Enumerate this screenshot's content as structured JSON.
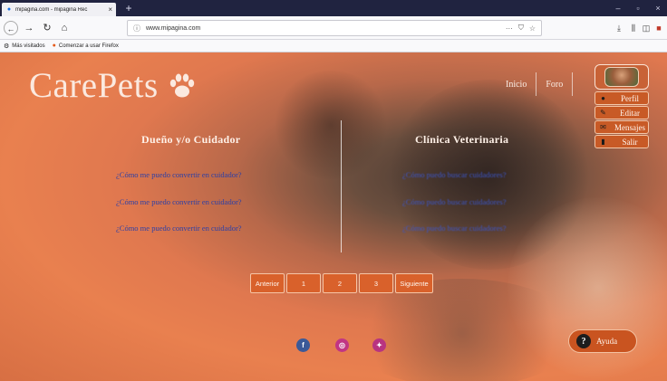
{
  "browser": {
    "tab_title": "mipagina.com - mipagina Rec",
    "tab_close": "×",
    "new_tab": "+",
    "url": "www.mipagina.com",
    "url_info_icon": "ⓘ",
    "url_more": "···",
    "url_shield": "⛉",
    "url_star": "☆",
    "win_min": "–",
    "win_max": "▫",
    "win_close": "×",
    "bookmarks": [
      {
        "label": "Más visitados",
        "icon": "gear-icon"
      },
      {
        "label": "Comenzar a usar Firefox",
        "icon": "firefox-icon"
      }
    ]
  },
  "site": {
    "logo": "CarePets",
    "nav": [
      "Inicio",
      "Foro"
    ],
    "user_menu": [
      {
        "label": "Perfil",
        "icon": "user-icon"
      },
      {
        "label": "Editar",
        "icon": "pencil-icon"
      },
      {
        "label": "Mensajes",
        "icon": "envelope-icon"
      },
      {
        "label": "Salir",
        "icon": "door-icon"
      }
    ],
    "left_title": "Dueño y/o Cuidador",
    "right_title": "Clínica Veterinaria",
    "left_questions": [
      "¿Cómo me puedo convertir en cuidador?",
      "¿Cómo me puedo convertir en cuidador?",
      "¿Cómo me puedo convertir en cuidador?"
    ],
    "right_questions": [
      "¿Cómo puedo buscar cuidadores?",
      "¿Cómo puedo buscar cuidadores?",
      "¿Cómo puedo buscar cuidadores?"
    ],
    "pagination": [
      "Anterior",
      "1",
      "2",
      "3",
      "Siguiente"
    ],
    "social": [
      {
        "name": "facebook-icon",
        "glyph": "f",
        "color": "#3b5998"
      },
      {
        "name": "instagram-icon",
        "glyph": "◎",
        "color": "#c13584"
      },
      {
        "name": "twitter-icon",
        "glyph": "✦",
        "color": "#b83380"
      }
    ],
    "help_label": "Ayuda",
    "help_glyph": "?",
    "colors": {
      "accent": "#d9612b",
      "link": "#2c3fa6"
    }
  }
}
